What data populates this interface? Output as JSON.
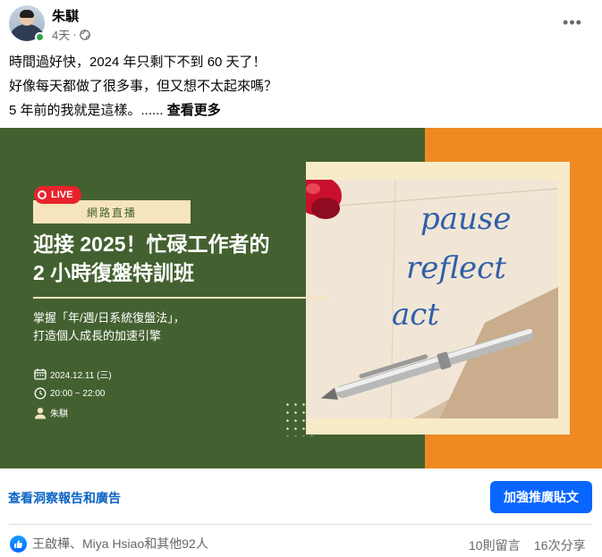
{
  "post": {
    "author": "朱騏",
    "time": "4天",
    "separator": "·",
    "text_lines": [
      "時間過好快，2024 年只剩下不到 60 天了！",
      "好像每天都做了很多事，但又想不太起來嗎？",
      "5 年前的我就是這樣。......"
    ],
    "see_more": "查看更多",
    "status_color": "#31a24c"
  },
  "banner": {
    "live_label": "LIVE",
    "tag": "網路直播",
    "title_line1": "迎接 2025！忙碌工作者的",
    "title_line2": "2 小時復盤特訓班",
    "subtitle_line1": "掌握「年/週/日系統復盤法」，",
    "subtitle_line2": "打造個人成長的加速引擎",
    "date": "2024.12.11 (三)",
    "time": "20:00 ~ 22:00",
    "host": "朱騏",
    "photo_words": [
      "pause",
      "reflect",
      "act"
    ],
    "colors": {
      "green": "#436130",
      "orange": "#ef8a22",
      "cream": "#f6e4bd",
      "live_red": "#e8232b"
    }
  },
  "actions": {
    "insights": "查看洞察報告和廣告",
    "boost": "加強推廣貼文",
    "boost_color": "#0866ff"
  },
  "footer": {
    "reactions": "王啟樺、Miya Hsiao和其他92人",
    "comments": "10則留言",
    "shares": "16次分享"
  },
  "icons": [
    "globe-icon",
    "more-icon",
    "calendar-icon",
    "clock-icon",
    "person-icon",
    "like-icon"
  ]
}
